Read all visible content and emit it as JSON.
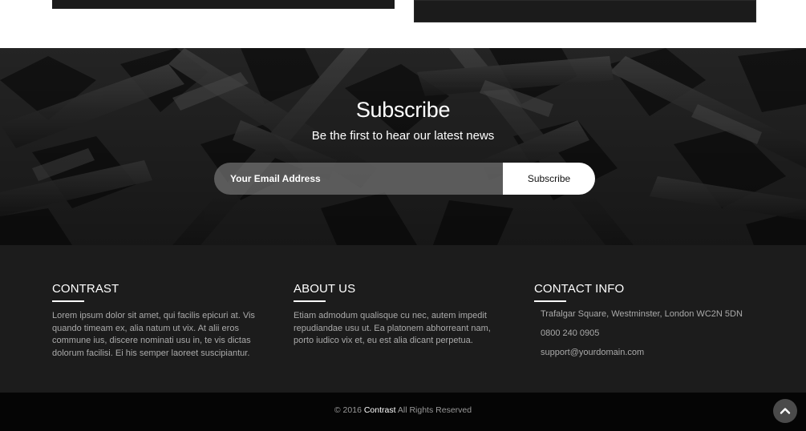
{
  "subscribe": {
    "title": "Subscribe",
    "subtitle": "Be the first to hear our latest news",
    "email_placeholder": "Your Email Address",
    "button_label": "Subscribe"
  },
  "footer": {
    "contrast": {
      "heading": "CONTRAST",
      "text": "Lorem ipsum dolor sit amet, qui facilis epicuri at. Vis quando timeam ex, alia natum ut vix. At alii eros commune ius, discere nominati usu in, te vis dictas dolorum facilisi. Ei his semper laoreet suscipiantur."
    },
    "about": {
      "heading": "ABOUT US",
      "text": "Etiam admodum qualisque cu nec, autem impedit repudiandae usu ut. Ea platonem abhorreant nam, porto iudico vix et, eu est alia dicant perpetua."
    },
    "contact": {
      "heading": "CONTACT INFO",
      "address": "Trafalgar Square, Westminster, London WC2N 5DN",
      "phone": "0800 240 0905",
      "email": "support@yourdomain.com"
    }
  },
  "bottom_bar": {
    "copyright_prefix": "© 2016",
    "brand": "Contrast",
    "copyright_suffix": "All Rights Reserved",
    "back_to_top_icon": "chevron-up-icon"
  },
  "colors": {
    "footer_bg": "#1c1c1c",
    "bottom_bar_bg": "#050505",
    "accent": "#ffffff"
  }
}
